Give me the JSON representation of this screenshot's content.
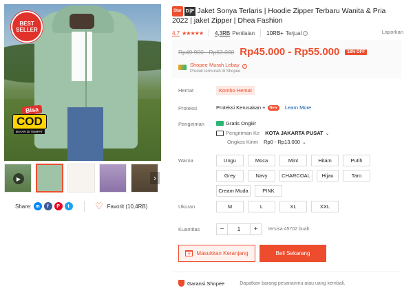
{
  "gallery": {
    "best_seller": "BEST SELLER",
    "cod_top": "Bisa",
    "cod_main": "COD",
    "cod_sub": "BAYAR DI TEMPAT",
    "thumb_next": "›"
  },
  "share": {
    "label": "Share:",
    "icons": [
      "messenger-icon",
      "facebook-icon",
      "pinterest-icon",
      "twitter-icon"
    ]
  },
  "favorite": {
    "label": "Favorit (10,4RB)"
  },
  "product": {
    "star_tag": "Star",
    "df_tag": "D|F",
    "title": "Jaket Sonya Terlaris | Hoodie Zipper Terbaru Wanita & Pria 2022 | jaket Zipper | Dhea Fashion",
    "rating": "4.7",
    "stars": "★★★★★",
    "reviews_count": "4,3RB",
    "reviews_label": "Penilaian",
    "sold_count": "10RB+",
    "sold_label": "Terjual",
    "report": "Laporkan"
  },
  "price": {
    "original": "Rp49.900 - Rp63.000",
    "current": "Rp45.000 - Rp55.000",
    "discount": "18% OFF",
    "shop_label": "Shopee Murah Lebay",
    "shop_sub": "Produk termurah di Shopee"
  },
  "labels": {
    "hemat": "Hemat",
    "proteksi": "Proteksi",
    "pengiriman": "Pengiriman",
    "warna": "Warna",
    "ukuran": "Ukuran",
    "kuantitas": "Kuantitas"
  },
  "hemat": {
    "tag": "Kombo Hemat"
  },
  "protection": {
    "text": "Proteksi Kerusakan +",
    "badge": "New",
    "link": "Learn More"
  },
  "shipping": {
    "free": "Gratis Ongkir",
    "to_label": "Pengiriman Ke",
    "to_value": "KOTA JAKARTA PUSAT",
    "cost_label": "Ongkos Kirim",
    "cost_value": "Rp0 - Rp13.000"
  },
  "colors": [
    "Ungu",
    "Moca",
    "Mint",
    "Hitam",
    "Putih",
    "Grey",
    "Navy",
    "CHARCOAL",
    "Hijau",
    "Taro",
    "Cream Muda",
    "PINK"
  ],
  "sizes": [
    "M",
    "L",
    "XL",
    "XXL"
  ],
  "quantity": {
    "value": "1",
    "minus": "−",
    "plus": "+",
    "stock": "tersisa 45702 buah"
  },
  "actions": {
    "cart": "Masukkan Keranjang",
    "buy": "Beli Sekarang"
  },
  "guarantee": {
    "title": "Garansi Shopee",
    "desc": "Dapatkan barang pesananmu atau uang kembali."
  },
  "theme": {
    "accent": "#ee4d2d"
  }
}
